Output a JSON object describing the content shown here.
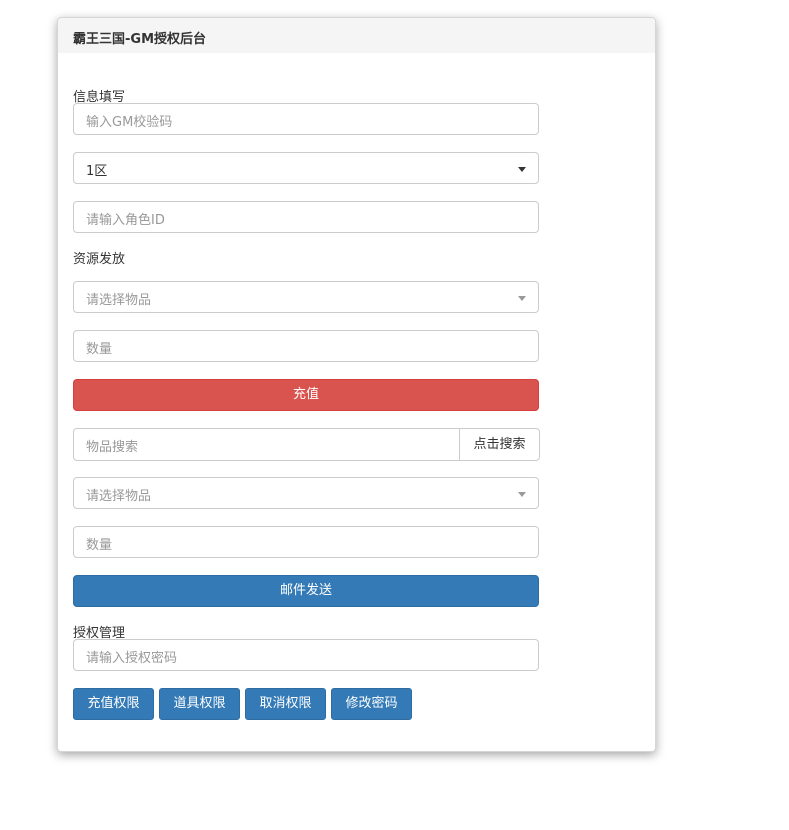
{
  "panel": {
    "title": "霸王三国-GM授权后台"
  },
  "info_section": {
    "label": "信息填写",
    "gm_code_placeholder": "输入GM校验码",
    "server_select_value": "1区",
    "role_id_placeholder": "请输入角色ID"
  },
  "resource_section": {
    "label": "资源发放",
    "item_select_placeholder": "请选择物品",
    "quantity_placeholder": "数量",
    "recharge_button": "充值"
  },
  "mail_section": {
    "search_placeholder": "物品搜索",
    "search_button": "点击搜索",
    "item_select_placeholder": "请选择物品",
    "quantity_placeholder": "数量",
    "send_button": "邮件发送"
  },
  "auth_section": {
    "label": "授权管理",
    "password_placeholder": "请输入授权密码",
    "buttons": [
      "充值权限",
      "道具权限",
      "取消权限",
      "修改密码"
    ]
  },
  "colors": {
    "danger": "#d9534f",
    "primary": "#337ab7",
    "header_bg": "#f5f5f5"
  }
}
